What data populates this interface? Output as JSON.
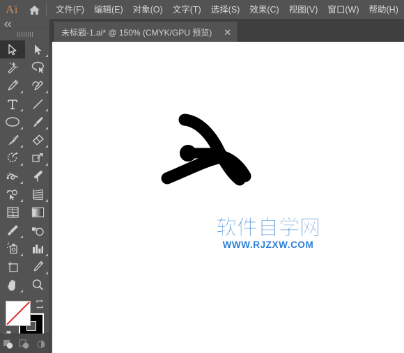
{
  "app": {
    "logo_text": "Ai",
    "home_icon": "home-icon"
  },
  "menubar": {
    "items": [
      {
        "label": "文件(F)",
        "name": "menu-file"
      },
      {
        "label": "编辑(E)",
        "name": "menu-edit"
      },
      {
        "label": "对象(O)",
        "name": "menu-object"
      },
      {
        "label": "文字(T)",
        "name": "menu-type"
      },
      {
        "label": "选择(S)",
        "name": "menu-select"
      },
      {
        "label": "效果(C)",
        "name": "menu-effect"
      },
      {
        "label": "视图(V)",
        "name": "menu-view"
      },
      {
        "label": "窗口(W)",
        "name": "menu-window"
      },
      {
        "label": "帮助(H)",
        "name": "menu-help"
      }
    ]
  },
  "tabbar": {
    "document_title": "未标题-1.ai* @ 150% (CMYK/GPU 预览)",
    "close_label": "✕"
  },
  "toolpanel": {
    "collapse_label": "◀◀",
    "tools": [
      {
        "name": "selection-tool",
        "active": true,
        "corner": false
      },
      {
        "name": "direct-selection-tool",
        "active": false,
        "corner": true
      },
      {
        "name": "magic-wand-tool",
        "active": false,
        "corner": false
      },
      {
        "name": "lasso-tool",
        "active": false,
        "corner": false
      },
      {
        "name": "pen-tool",
        "active": false,
        "corner": true
      },
      {
        "name": "curvature-tool",
        "active": false,
        "corner": true
      },
      {
        "name": "type-tool",
        "active": false,
        "corner": true
      },
      {
        "name": "line-segment-tool",
        "active": false,
        "corner": true
      },
      {
        "name": "ellipse-tool",
        "active": false,
        "corner": true
      },
      {
        "name": "paintbrush-tool",
        "active": false,
        "corner": true
      },
      {
        "name": "blob-brush-tool",
        "active": false,
        "corner": true
      },
      {
        "name": "eraser-tool",
        "active": false,
        "corner": true
      },
      {
        "name": "rotate-tool",
        "active": false,
        "corner": true
      },
      {
        "name": "scale-tool",
        "active": false,
        "corner": true
      },
      {
        "name": "width-tool",
        "active": false,
        "corner": true
      },
      {
        "name": "free-transform-tool",
        "active": false,
        "corner": false
      },
      {
        "name": "shape-builder-tool",
        "active": false,
        "corner": true
      },
      {
        "name": "perspective-grid-tool",
        "active": false,
        "corner": true
      },
      {
        "name": "mesh-tool",
        "active": false,
        "corner": false
      },
      {
        "name": "gradient-tool",
        "active": false,
        "corner": false
      },
      {
        "name": "eyedropper-tool",
        "active": false,
        "corner": true
      },
      {
        "name": "blend-tool",
        "active": false,
        "corner": false
      },
      {
        "name": "symbol-sprayer-tool",
        "active": false,
        "corner": true
      },
      {
        "name": "column-graph-tool",
        "active": false,
        "corner": true
      },
      {
        "name": "artboard-tool",
        "active": false,
        "corner": false
      },
      {
        "name": "slice-tool",
        "active": false,
        "corner": true
      },
      {
        "name": "hand-tool",
        "active": false,
        "corner": true
      },
      {
        "name": "zoom-tool",
        "active": false,
        "corner": false
      }
    ],
    "colors": {
      "fill": "#ffffff",
      "fill_is_none": true,
      "none_slash": "#e02424",
      "stroke": "#000000"
    },
    "swatch_modes": [
      {
        "name": "color-mode-button",
        "label": ""
      },
      {
        "name": "gradient-mode-button",
        "label": ""
      },
      {
        "name": "none-mode-button",
        "label": ""
      }
    ],
    "screen_modes": [
      {
        "name": "drawing-mode-normal-button"
      },
      {
        "name": "drawing-mode-behind-button"
      },
      {
        "name": "drawing-mode-inside-button"
      }
    ]
  },
  "canvas": {
    "background": "#ffffff",
    "artwork_name": "calligraphy-stroke-artwork",
    "artwork_color": "#000000",
    "zoom_level": "150%"
  },
  "watermark": {
    "chinese": "软件自学网",
    "url": "WWW.RJZXW.COM",
    "color": "#2b7fd4"
  }
}
